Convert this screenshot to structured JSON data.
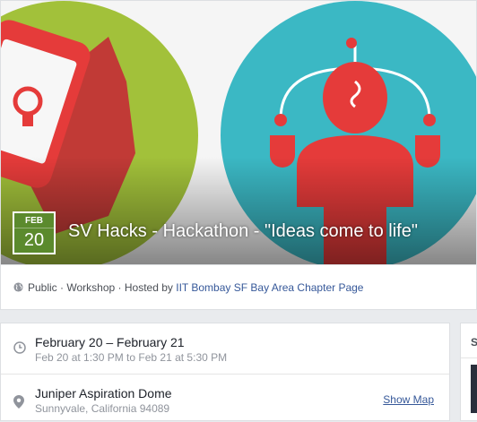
{
  "cover": {
    "month": "FEB",
    "day": "20",
    "title": "SV Hacks - Hackathon - \"Ideas come to life\"",
    "colors": {
      "green_circle": "#a2c13a",
      "teal_circle": "#3bb8c4",
      "red": "#e53b3a"
    }
  },
  "meta": {
    "privacy": "Public",
    "category": "Workshop",
    "hosted_prefix": "Hosted by",
    "host": "IIT Bombay SF Bay Area Chapter Page",
    "separator": "·"
  },
  "details": {
    "date_range": "February 20 – February 21",
    "date_sub": "Feb 20 at 1:30 PM to Feb 21 at 5:30 PM",
    "venue": "Juniper Aspiration Dome",
    "address": "Sunnyvale, California 94089",
    "show_map": "Show Map"
  },
  "side": {
    "label": "S"
  }
}
